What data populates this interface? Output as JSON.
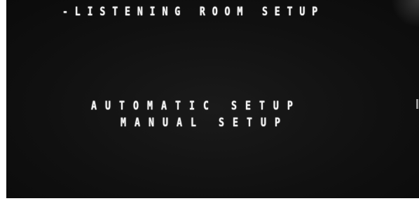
{
  "screen": {
    "title": "-LISTENING ROOM SETUP",
    "menu": {
      "items": [
        {
          "label": "AUTOMATIC SETUP"
        },
        {
          "label": "MANUAL SETUP"
        }
      ]
    },
    "colors": {
      "background": "#121212",
      "text": "#f2f2f2"
    }
  }
}
